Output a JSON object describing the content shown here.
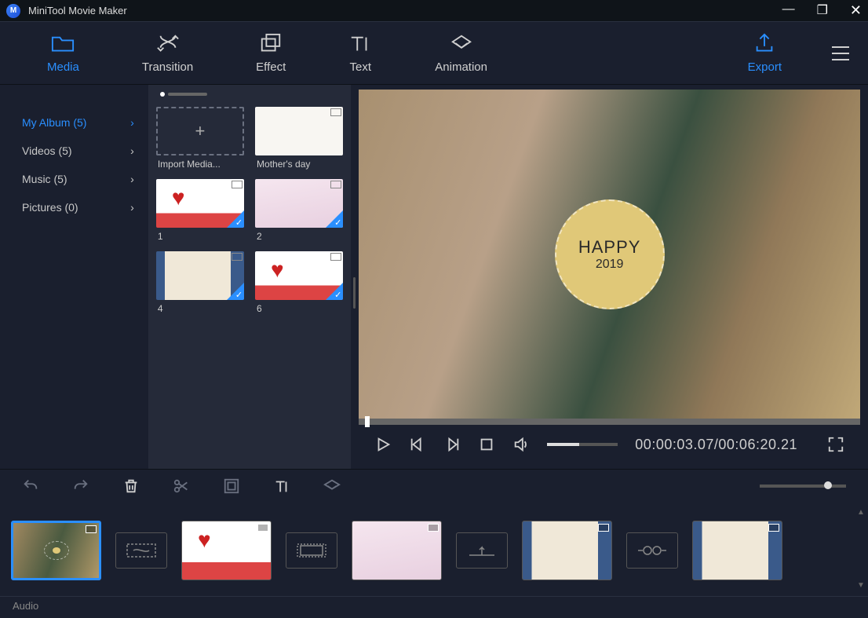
{
  "app": {
    "title": "MiniTool Movie Maker",
    "logo_letter": "M"
  },
  "topbar": {
    "media": "Media",
    "transition": "Transition",
    "effect": "Effect",
    "text": "Text",
    "animation": "Animation",
    "export": "Export"
  },
  "sidebar": {
    "items": [
      {
        "label": "My Album (5)",
        "active": true
      },
      {
        "label": "Videos (5)",
        "active": false
      },
      {
        "label": "Music (5)",
        "active": false
      },
      {
        "label": "Pictures (0)",
        "active": false
      }
    ]
  },
  "media": {
    "import_label": "Import Media...",
    "import_plus": "+",
    "items": [
      {
        "label": "Mother's day",
        "thumb": "mom",
        "checked": false
      },
      {
        "label": "1",
        "thumb": "love",
        "checked": true
      },
      {
        "label": "2",
        "thumb": "pink",
        "checked": true
      },
      {
        "label": "4",
        "thumb": "screen",
        "checked": true
      },
      {
        "label": "6",
        "thumb": "love",
        "checked": true
      }
    ]
  },
  "preview": {
    "badge_line1": "HAPPY",
    "badge_line2": "2019",
    "time_current": "00:00:03.07",
    "time_total": "00:06:20.21",
    "time_sep": "/"
  },
  "timeline": {
    "audio_label": "Audio"
  }
}
